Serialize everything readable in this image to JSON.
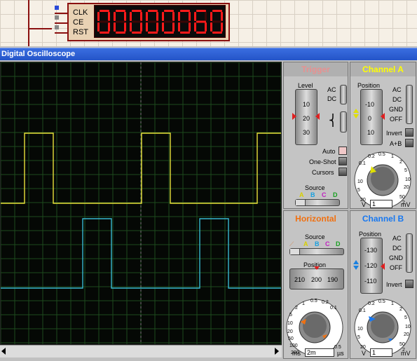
{
  "schematic": {
    "pins": [
      "CLK",
      "CE",
      "RST"
    ],
    "display_value": "00000060"
  },
  "window": {
    "title": "Digital Oscilloscope"
  },
  "trigger": {
    "title": "Trigger",
    "level_label": "Level",
    "level_ticks": [
      "10",
      "20",
      "30"
    ],
    "ac_label": "AC",
    "dc_label": "DC",
    "auto_label": "Auto",
    "oneshot_label": "One-Shot",
    "cursors_label": "Cursors",
    "source_label": "Source",
    "sources": [
      "A",
      "B",
      "C",
      "D"
    ]
  },
  "channel_a": {
    "title": "Channel A",
    "position_label": "Position",
    "position_ticks": [
      "-10",
      "0",
      "10"
    ],
    "coupling": [
      "AC",
      "DC",
      "GND",
      "OFF"
    ],
    "invert_label": "Invert",
    "aplusb_label": "A+B",
    "dial_ticks": [
      "0.2",
      "0.5",
      "1",
      "2",
      "5",
      "10",
      "20",
      "50",
      "0.1"
    ],
    "dial_left": "20",
    "dial_right": "2",
    "unit_left": "V",
    "unit_right": "mV",
    "value": "1"
  },
  "horizontal": {
    "title": "Horizontal",
    "source_label": "Source",
    "sources": [
      "A",
      "B",
      "C",
      "D"
    ],
    "position_label": "Position",
    "position_ticks": [
      "210",
      "200",
      "190"
    ],
    "dial_ticks": [
      "0.5",
      "0.2",
      "0.1",
      "1",
      "2",
      "5",
      "10",
      "20",
      "50",
      "100",
      "200"
    ],
    "dial_left": "200",
    "dial_right": "0.5",
    "unit_left": "ms",
    "unit_right": "µs",
    "value": "2m"
  },
  "channel_b": {
    "title": "Channel B",
    "position_label": "Position",
    "position_ticks": [
      "-130",
      "-120",
      "-110"
    ],
    "coupling": [
      "AC",
      "DC",
      "GND",
      "OFF"
    ],
    "invert_label": "Invert",
    "dial_ticks": [
      "0.2",
      "0.5",
      "1",
      "2",
      "5",
      "10",
      "20",
      "50",
      "0.1"
    ],
    "dial_left": "20",
    "dial_right": "2",
    "unit_left": "V",
    "unit_right": "mV",
    "value": "1"
  },
  "colors": {
    "trace_a": "#e8e03a",
    "trace_b": "#38b8d0",
    "channel_a_title": "#ffff00",
    "channel_b_title": "#1878f0",
    "horizontal_title": "#f07010",
    "trigger_title": "#e89090",
    "segment_red": "#ff1a1a"
  },
  "icons": [
    "up-arrow-icon",
    "down-arrow-icon",
    "left-arrow-icon",
    "right-arrow-icon",
    "rising-edge-icon",
    "falling-edge-icon"
  ]
}
